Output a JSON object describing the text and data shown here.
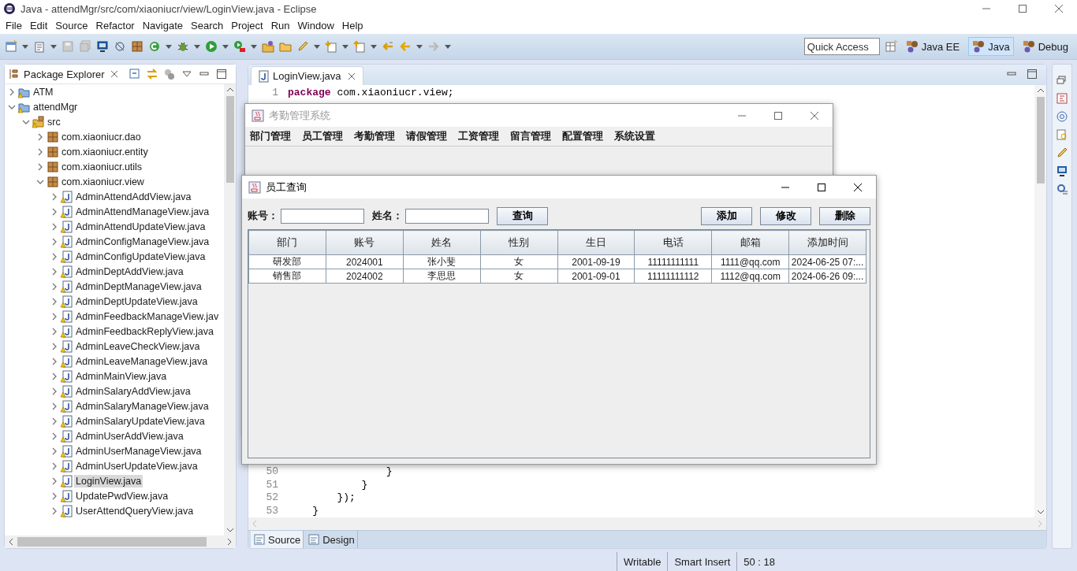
{
  "window": {
    "title": "Java - attendMgr/src/com/xiaoniucr/view/LoginView.java - Eclipse"
  },
  "menu": [
    "File",
    "Edit",
    "Source",
    "Refactor",
    "Navigate",
    "Search",
    "Project",
    "Run",
    "Window",
    "Help"
  ],
  "quick_access": {
    "placeholder": "Quick Access"
  },
  "perspectives": [
    {
      "label": "Java EE",
      "selected": false
    },
    {
      "label": "Java",
      "selected": true
    },
    {
      "label": "Debug",
      "selected": false
    }
  ],
  "package_explorer": {
    "title": "Package Explorer",
    "tree": [
      {
        "label": "ATM",
        "kind": "project",
        "expanded": false,
        "selected": false
      },
      {
        "label": "attendMgr",
        "kind": "project",
        "expanded": true,
        "selected": false,
        "children": [
          {
            "label": "src",
            "kind": "source-folder",
            "expanded": true,
            "selected": false,
            "children": [
              {
                "label": "com.xiaoniucr.dao",
                "kind": "package",
                "expanded": false,
                "selected": false
              },
              {
                "label": "com.xiaoniucr.entity",
                "kind": "package",
                "expanded": false,
                "selected": false
              },
              {
                "label": "com.xiaoniucr.utils",
                "kind": "package",
                "expanded": false,
                "selected": false
              },
              {
                "label": "com.xiaoniucr.view",
                "kind": "package",
                "expanded": true,
                "selected": false,
                "children": [
                  {
                    "label": "AdminAttendAddView.java",
                    "kind": "java-file",
                    "expanded": false,
                    "selected": false
                  },
                  {
                    "label": "AdminAttendManageView.java",
                    "kind": "java-file",
                    "expanded": false,
                    "selected": false
                  },
                  {
                    "label": "AdminAttendUpdateView.java",
                    "kind": "java-file",
                    "expanded": false,
                    "selected": false
                  },
                  {
                    "label": "AdminConfigManageView.java",
                    "kind": "java-file",
                    "expanded": false,
                    "selected": false
                  },
                  {
                    "label": "AdminConfigUpdateView.java",
                    "kind": "java-file",
                    "expanded": false,
                    "selected": false
                  },
                  {
                    "label": "AdminDeptAddView.java",
                    "kind": "java-file",
                    "expanded": false,
                    "selected": false
                  },
                  {
                    "label": "AdminDeptManageView.java",
                    "kind": "java-file",
                    "expanded": false,
                    "selected": false
                  },
                  {
                    "label": "AdminDeptUpdateView.java",
                    "kind": "java-file",
                    "expanded": false,
                    "selected": false
                  },
                  {
                    "label": "AdminFeedbackManageView.jav",
                    "kind": "java-file",
                    "expanded": false,
                    "selected": false
                  },
                  {
                    "label": "AdminFeedbackReplyView.java",
                    "kind": "java-file",
                    "expanded": false,
                    "selected": false
                  },
                  {
                    "label": "AdminLeaveCheckView.java",
                    "kind": "java-file",
                    "expanded": false,
                    "selected": false
                  },
                  {
                    "label": "AdminLeaveManageView.java",
                    "kind": "java-file",
                    "expanded": false,
                    "selected": false
                  },
                  {
                    "label": "AdminMainView.java",
                    "kind": "java-file",
                    "expanded": false,
                    "selected": false
                  },
                  {
                    "label": "AdminSalaryAddView.java",
                    "kind": "java-file",
                    "expanded": false,
                    "selected": false
                  },
                  {
                    "label": "AdminSalaryManageView.java",
                    "kind": "java-file",
                    "expanded": false,
                    "selected": false
                  },
                  {
                    "label": "AdminSalaryUpdateView.java",
                    "kind": "java-file",
                    "expanded": false,
                    "selected": false
                  },
                  {
                    "label": "AdminUserAddView.java",
                    "kind": "java-file",
                    "expanded": false,
                    "selected": false
                  },
                  {
                    "label": "AdminUserManageView.java",
                    "kind": "java-file",
                    "expanded": false,
                    "selected": false
                  },
                  {
                    "label": "AdminUserUpdateView.java",
                    "kind": "java-file",
                    "expanded": false,
                    "selected": false
                  },
                  {
                    "label": "LoginView.java",
                    "kind": "java-file",
                    "expanded": false,
                    "selected": true
                  },
                  {
                    "label": "UpdatePwdView.java",
                    "kind": "java-file",
                    "expanded": false,
                    "selected": false
                  },
                  {
                    "label": "UserAttendQueryView.java",
                    "kind": "java-file",
                    "expanded": false,
                    "selected": false
                  }
                ]
              }
            ]
          }
        ]
      }
    ]
  },
  "editor": {
    "tabs": [
      {
        "label": "LoginView.java",
        "selected": true
      }
    ],
    "top_lines": [
      {
        "number": "1",
        "tokens": [
          {
            "kind": "keyword",
            "text": "package"
          },
          {
            "kind": "plain",
            "text": " com.xiaoniucr.view;"
          }
        ]
      }
    ],
    "bottom_lines": [
      {
        "number": "50",
        "tokens": [
          {
            "kind": "plain",
            "text": "                }"
          }
        ]
      },
      {
        "number": "51",
        "tokens": [
          {
            "kind": "plain",
            "text": "            }"
          }
        ]
      },
      {
        "number": "52",
        "tokens": [
          {
            "kind": "plain",
            "text": "        });"
          }
        ]
      },
      {
        "number": "53",
        "tokens": [
          {
            "kind": "plain",
            "text": "    }"
          }
        ]
      }
    ],
    "bottom_tabs": [
      {
        "label": "Source",
        "selected": true
      },
      {
        "label": "Design",
        "selected": false
      }
    ]
  },
  "status_bar": [
    "Writable",
    "Smart Insert",
    "50 : 18"
  ],
  "app_window": {
    "title": "考勤管理系统",
    "menu": [
      "部门管理",
      "员工管理",
      "考勤管理",
      "请假管理",
      "工资管理",
      "留言管理",
      "配置管理",
      "系统设置"
    ]
  },
  "dialog": {
    "title": "员工查询",
    "fields": [
      {
        "label": "账号："
      },
      {
        "label": "姓名："
      }
    ],
    "search_button": "查询",
    "action_buttons": [
      "添加",
      "修改",
      "删除"
    ],
    "table": {
      "columns": [
        "部门",
        "账号",
        "姓名",
        "性别",
        "生日",
        "电话",
        "邮箱",
        "添加时间"
      ],
      "rows": [
        [
          "研发部",
          "2024001",
          "张小斐",
          "女",
          "2001-09-19",
          "11111111111",
          "1111@qq.com",
          "2024-06-25 07:..."
        ],
        [
          "销售部",
          "2024002",
          "李思思",
          "女",
          "2001-09-01",
          "11111111112",
          "1112@qq.com",
          "2024-06-26 09:..."
        ]
      ]
    }
  }
}
